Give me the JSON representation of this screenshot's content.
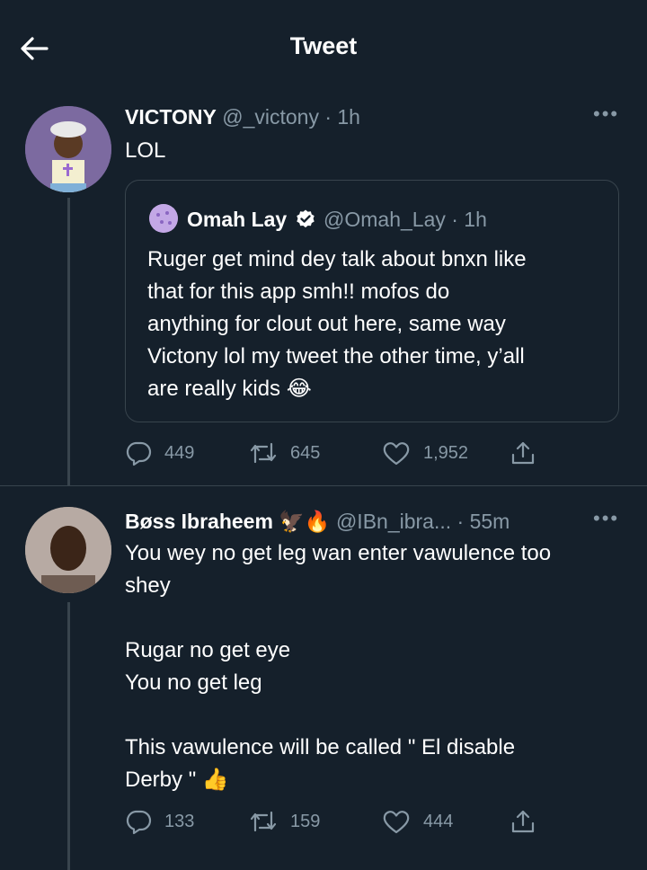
{
  "header": {
    "title": "Tweet",
    "back_icon": "arrow-left-icon"
  },
  "tweet1": {
    "name": "VICTONY",
    "handle": "@_victony",
    "time": "· 1h",
    "text": "LOL",
    "quote": {
      "name": "Omah Lay",
      "verified": true,
      "handle": "@Omah_Lay",
      "time": "· 1h",
      "lines": [
        "Ruger get mind dey talk about bnxn like",
        "that for this app smh!! mofos do",
        "anything for clout out here, same way",
        "Victony lol my tweet the other time, y’all",
        "are really kids 😂"
      ]
    },
    "stats": {
      "replies": "449",
      "retweets": "645",
      "likes": "1,952"
    }
  },
  "tweet2": {
    "name": "Bøss Ibraheem 🦅🔥",
    "handle": "@IBn_ibra...",
    "time": "· 55m",
    "lines": [
      "You wey no get leg wan enter vawulence too",
      "shey",
      "",
      "Rugar no get eye",
      "You no get leg",
      "",
      "This vawulence will be called \" El disable",
      "Derby \" 👍"
    ],
    "stats": {
      "replies": "133",
      "retweets": "159",
      "likes": "444"
    }
  },
  "colors": {
    "background": "#15202b",
    "muted": "#8899a6",
    "line": "#38444d",
    "verified": "#ffffff"
  }
}
